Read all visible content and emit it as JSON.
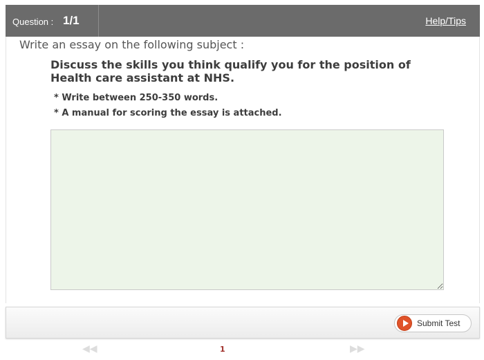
{
  "header": {
    "question_label": "Question :",
    "question_number": "1/1",
    "help_link": "Help/Tips"
  },
  "main": {
    "instruction": "Write an essay on the following subject :",
    "subject": "Discuss the skills you think qualify you for the position of Health care assistant at NHS.",
    "notes": [
      "* Write between 250-350 words.",
      "* A manual for scoring the essay is attached."
    ],
    "essay_value": ""
  },
  "footer": {
    "submit_label": "Submit Test"
  },
  "pager": {
    "prev": "◀◀",
    "next": "▶▶",
    "current_page": "1"
  },
  "colors": {
    "header_bg": "#6b6b6b",
    "essay_bg": "#edf5e9",
    "submit_icon": "#e0532a",
    "page_number": "#a0302a"
  },
  "icons": {
    "submit": "play-circle-icon",
    "prev": "double-left-arrow-icon",
    "next": "double-right-arrow-icon"
  }
}
